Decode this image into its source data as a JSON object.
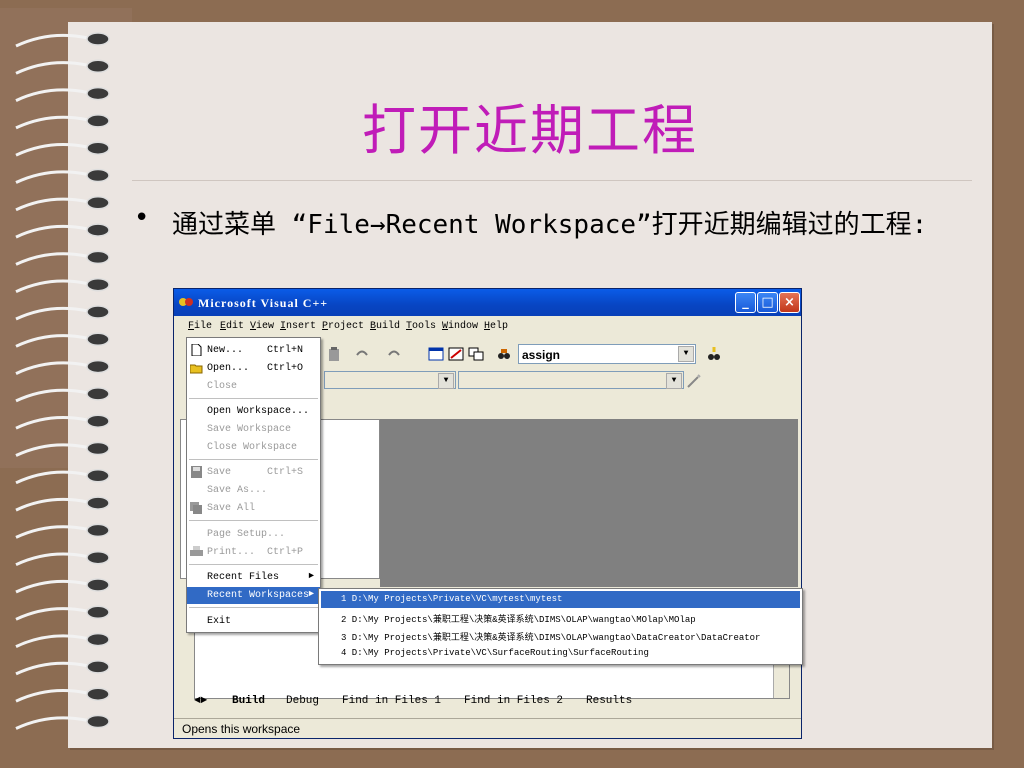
{
  "slide": {
    "title": "打开近期工程",
    "bullet": "•",
    "body": "通过菜单 “File→Recent Workspace”打开近期编辑过的工程:"
  },
  "colors": {
    "title": "#c01cb8",
    "highlight": "#316ac5",
    "titlebar": "#0a5ce8"
  },
  "window": {
    "title": "Microsoft Visual C++",
    "menu": [
      "File",
      "Edit",
      "View",
      "Insert",
      "Project",
      "Build",
      "Tools",
      "Window",
      "Help"
    ],
    "combo_value": "assign",
    "status": "Opens this workspace",
    "tabs": [
      "Build",
      "Debug",
      "Find in Files 1",
      "Find in Files 2",
      "Results"
    ]
  },
  "file_menu": {
    "items": [
      {
        "label": "New...",
        "shortcut": "Ctrl+N",
        "enabled": true,
        "icon": "new-file-icon"
      },
      {
        "label": "Open...",
        "shortcut": "Ctrl+O",
        "enabled": true,
        "icon": "open-folder-icon"
      },
      {
        "label": "Close",
        "shortcut": "",
        "enabled": false
      },
      {
        "label": "Open Workspace...",
        "shortcut": "",
        "enabled": true
      },
      {
        "label": "Save Workspace",
        "shortcut": "",
        "enabled": false
      },
      {
        "label": "Close Workspace",
        "shortcut": "",
        "enabled": false
      },
      {
        "label": "Save",
        "shortcut": "Ctrl+S",
        "enabled": false,
        "icon": "save-icon"
      },
      {
        "label": "Save As...",
        "shortcut": "",
        "enabled": false
      },
      {
        "label": "Save All",
        "shortcut": "",
        "enabled": false,
        "icon": "save-all-icon"
      },
      {
        "label": "Page Setup...",
        "shortcut": "",
        "enabled": false
      },
      {
        "label": "Print...",
        "shortcut": "Ctrl+P",
        "enabled": false,
        "icon": "print-icon"
      },
      {
        "label": "Recent Files",
        "shortcut": "",
        "enabled": true,
        "submenu": true
      },
      {
        "label": "Recent Workspaces",
        "shortcut": "",
        "enabled": true,
        "submenu": true,
        "highlighted": true
      },
      {
        "label": "Exit",
        "shortcut": "",
        "enabled": true
      }
    ]
  },
  "recent_workspaces": [
    "1 D:\\My Projects\\Private\\VC\\mytest\\mytest",
    "2 D:\\My Projects\\兼职工程\\决策&英译系统\\DIMS\\OLAP\\wangtao\\MOlap\\MOlap",
    "3 D:\\My Projects\\兼职工程\\决策&英译系统\\DIMS\\OLAP\\wangtao\\DataCreator\\DataCreator",
    "4 D:\\My Projects\\Private\\VC\\SurfaceRouting\\SurfaceRouting"
  ]
}
